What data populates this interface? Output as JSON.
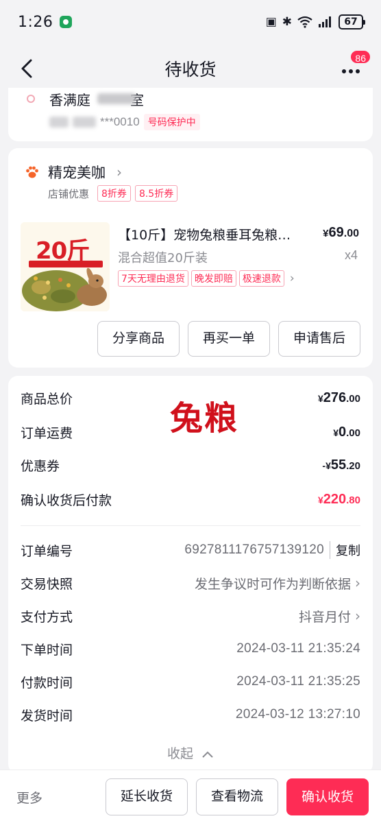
{
  "status_bar": {
    "time": "1:26",
    "battery": "67"
  },
  "nav": {
    "title": "待收货",
    "badge": "86"
  },
  "address": {
    "line1": "香满庭",
    "line1_tail": "室",
    "phone_suffix": "***0010",
    "protect_tag": "号码保护中"
  },
  "shop": {
    "name": "精宠美咖",
    "promo_label": "店铺优惠",
    "coupons": [
      "8折券",
      "8.5折券"
    ]
  },
  "product": {
    "image_text": "20斤",
    "title": "【10斤】宠物兔粮垂耳兔粮…",
    "price_symbol": "¥",
    "price_int": "69",
    "price_cents": ".00",
    "spec": "混合超值20斤装",
    "qty": "x4",
    "services": [
      "7天无理由退货",
      "晚发即赔",
      "极速退款"
    ],
    "actions": [
      "分享商品",
      "再买一单",
      "申请售后"
    ]
  },
  "summary": {
    "watermark": "兔粮",
    "rows": [
      {
        "label": "商品总价",
        "prefix": "",
        "sym": "¥",
        "int": "276",
        "cents": ".00"
      },
      {
        "label": "订单运费",
        "prefix": "",
        "sym": "¥",
        "int": "0",
        "cents": ".00"
      },
      {
        "label": "优惠券",
        "prefix": "-",
        "sym": "¥",
        "int": "55",
        "cents": ".20"
      },
      {
        "label": "确认收货后付款",
        "prefix": "",
        "sym": "¥",
        "int": "220",
        "cents": ".80"
      }
    ],
    "details": [
      {
        "label": "订单编号",
        "value": "6927811176757139120",
        "action": "复制"
      },
      {
        "label": "交易快照",
        "value": "发生争议时可作为判断依据"
      },
      {
        "label": "支付方式",
        "value": "抖音月付"
      },
      {
        "label": "下单时间",
        "value": "2024-03-11 21:35:24"
      },
      {
        "label": "付款时间",
        "value": "2024-03-11 21:35:25"
      },
      {
        "label": "发货时间",
        "value": "2024-03-12 13:27:10"
      }
    ],
    "collapse_label": "收起"
  },
  "bottom": {
    "more": "更多",
    "extend": "延长收货",
    "logistics": "查看物流",
    "confirm": "确认收货"
  },
  "colors": {
    "accent": "#fe2c55",
    "background": "#f3f3f5",
    "watermark": "#d0101b"
  }
}
